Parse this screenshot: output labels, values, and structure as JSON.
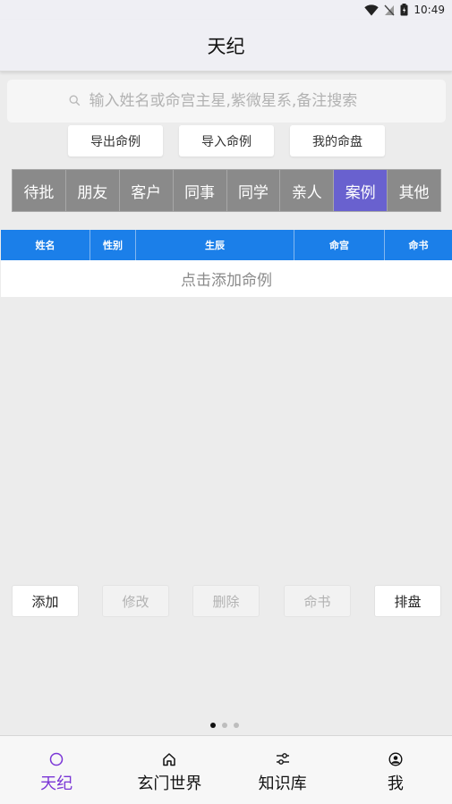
{
  "status_bar": {
    "time": "10:49"
  },
  "header": {
    "title": "天纪"
  },
  "search": {
    "placeholder": "输入姓名或命宫主星,紫微星系,备注搜索"
  },
  "actions": {
    "export_label": "导出命例",
    "import_label": "导入命例",
    "my_chart_label": "我的命盘"
  },
  "categories": {
    "items": [
      "待批",
      "朋友",
      "客户",
      "同事",
      "同学",
      "亲人",
      "案例",
      "其他"
    ],
    "active": "案例"
  },
  "table": {
    "columns": [
      "姓名",
      "性别",
      "生辰",
      "命宫",
      "命书"
    ],
    "empty_text": "点击添加命例"
  },
  "bottom_buttons": {
    "add": "添加",
    "edit": "修改",
    "delete": "删除",
    "book": "命书",
    "arrange": "排盘"
  },
  "nav": {
    "items": [
      {
        "label": "天纪",
        "icon": "circle-icon"
      },
      {
        "label": "玄门世界",
        "icon": "home-icon"
      },
      {
        "label": "知识库",
        "icon": "sliders-icon"
      },
      {
        "label": "我",
        "icon": "user-circle-icon"
      }
    ],
    "active": "天纪"
  },
  "colors": {
    "accent": "#6961cf",
    "table_header": "#1b7fe9",
    "nav_active": "#7a36d6"
  }
}
